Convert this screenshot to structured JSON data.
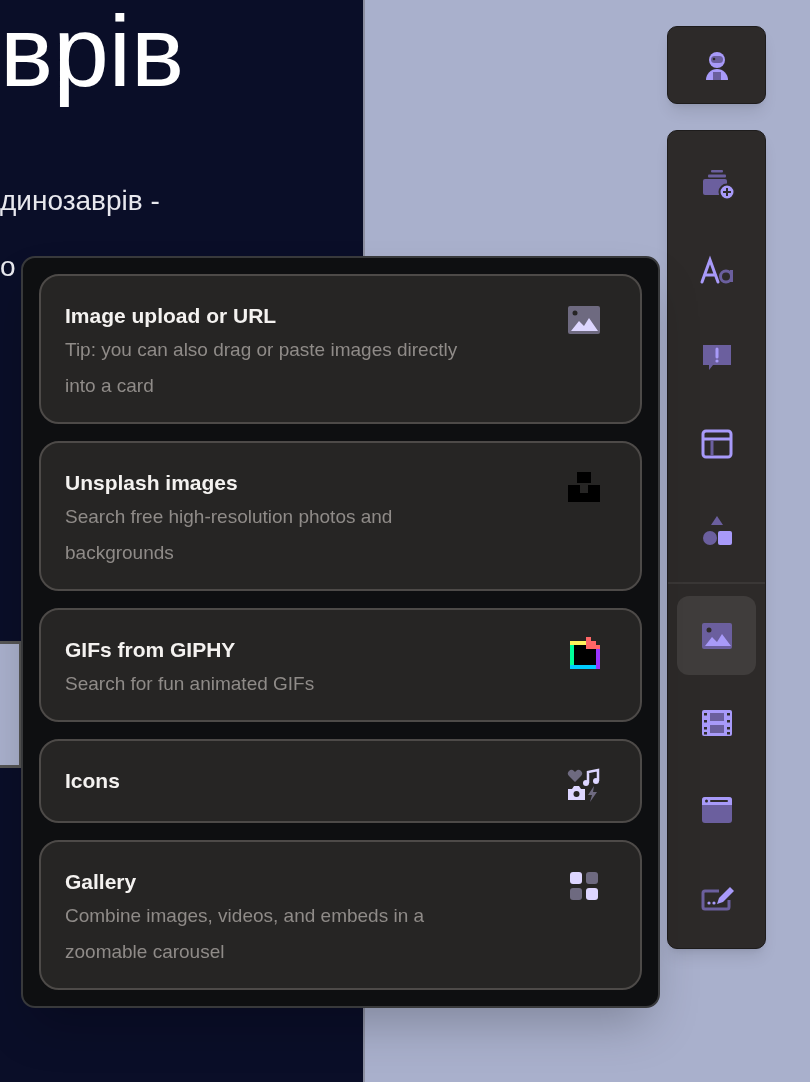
{
  "document": {
    "heading": "врів",
    "lines": [
      "динозаврів -",
      "о"
    ]
  },
  "toolbar": {
    "groups": [
      {
        "items": [
          {
            "kind": "card",
            "selected": false
          },
          {
            "kind": "text",
            "selected": false
          },
          {
            "kind": "callout",
            "selected": false
          },
          {
            "kind": "layout",
            "selected": false
          },
          {
            "kind": "shapes",
            "selected": false
          }
        ]
      },
      {
        "items": [
          {
            "kind": "image",
            "selected": true
          },
          {
            "kind": "video",
            "selected": false
          },
          {
            "kind": "embed",
            "selected": false
          },
          {
            "kind": "form",
            "selected": false
          }
        ]
      }
    ]
  },
  "menu": {
    "options": [
      {
        "kind": "upload",
        "title": "Image upload or URL",
        "description": "Tip: you can also drag or paste images directly into a card"
      },
      {
        "kind": "unsplash",
        "title": "Unsplash images",
        "description": "Search free high-resolution photos and backgrounds"
      },
      {
        "kind": "giphy",
        "title": "GIFs from GIPHY",
        "description": "Search for fun animated GIFs"
      },
      {
        "kind": "icons",
        "title": "Icons"
      },
      {
        "kind": "gallery",
        "title": "Gallery",
        "description": "Combine images, videos, and embeds in a zoomable carousel"
      }
    ]
  }
}
